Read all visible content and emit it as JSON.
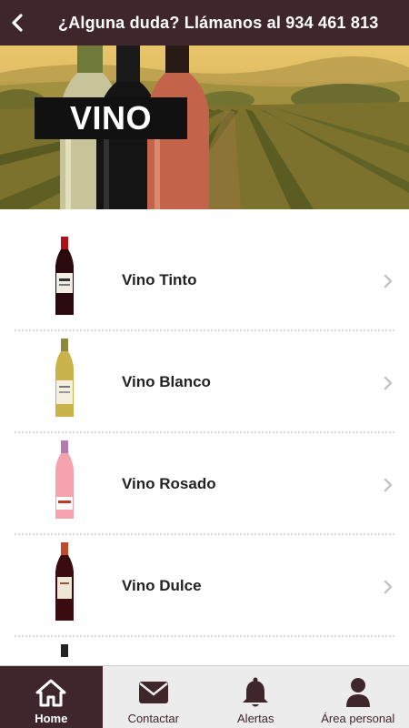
{
  "header": {
    "title": "¿Alguna duda? Llámanos al 934 461 813",
    "back_icon": "chevron-left-icon"
  },
  "hero": {
    "label": "VINO"
  },
  "categories": [
    {
      "label": "Vino Tinto",
      "bottle_color": "#5a1018",
      "label_color": "#f1ede4"
    },
    {
      "label": "Vino Blanco",
      "bottle_color": "#c9b34a",
      "label_color": "#f4efde"
    },
    {
      "label": "Vino Rosado",
      "bottle_color": "#f3a2ae",
      "label_color": "#ffffff"
    },
    {
      "label": "Vino Dulce",
      "bottle_color": "#3a0c10",
      "label_color": "#efe6d8"
    }
  ],
  "tabs": [
    {
      "label": "Home",
      "icon": "home-icon",
      "active": true
    },
    {
      "label": "Contactar",
      "icon": "envelope-icon",
      "active": false
    },
    {
      "label": "Alertas",
      "icon": "bell-icon",
      "active": false
    },
    {
      "label": "Área personal",
      "icon": "user-icon",
      "active": false
    }
  ],
  "colors": {
    "primary": "#3f262a",
    "tabbar": "#ececec",
    "text": "#222222",
    "chevron": "#c4c4c4"
  }
}
